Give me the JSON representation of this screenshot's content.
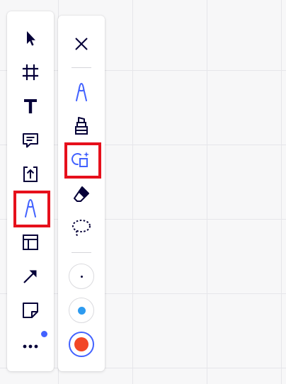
{
  "colors": {
    "accent": "#4262ff",
    "highlight_box": "#e6101c",
    "icon": "#050038",
    "notification": "#4262ff"
  },
  "main_toolbar": {
    "tools": [
      {
        "name": "select",
        "icon": "cursor-arrow-icon",
        "active": false
      },
      {
        "name": "frame",
        "icon": "frame-icon",
        "active": false
      },
      {
        "name": "text",
        "icon": "text-icon",
        "active": false
      },
      {
        "name": "comment",
        "icon": "comment-icon",
        "active": false
      },
      {
        "name": "upload",
        "icon": "upload-icon",
        "active": false
      },
      {
        "name": "pen",
        "icon": "pen-icon",
        "active": true,
        "highlighted": true
      },
      {
        "name": "templates",
        "icon": "layout-template-icon",
        "active": false
      },
      {
        "name": "connection-line",
        "icon": "arrow-line-icon",
        "active": false
      },
      {
        "name": "sticky-note",
        "icon": "sticky-note-icon",
        "active": false
      },
      {
        "name": "more",
        "icon": "more-dots-icon",
        "active": false,
        "has_notification": true
      }
    ]
  },
  "pen_toolbar": {
    "tools": [
      {
        "name": "close",
        "icon": "close-icon",
        "active": false
      },
      {
        "name": "pen",
        "icon": "pen-icon",
        "active": true
      },
      {
        "name": "highlighter",
        "icon": "highlighter-icon",
        "active": false
      },
      {
        "name": "smart-drawing",
        "icon": "smart-shapes-icon",
        "active": true,
        "highlighted": true
      },
      {
        "name": "eraser",
        "icon": "eraser-icon",
        "active": false
      },
      {
        "name": "lasso",
        "icon": "lasso-icon",
        "active": false
      }
    ],
    "sizes": [
      {
        "name": "size-small",
        "color": "#050038",
        "selected": false
      },
      {
        "name": "size-medium",
        "color": "#2d9bf0",
        "selected": false
      },
      {
        "name": "size-large",
        "color": "#f24726",
        "selected": true
      }
    ]
  }
}
